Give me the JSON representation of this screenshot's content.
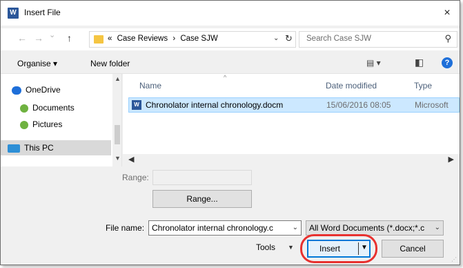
{
  "window": {
    "title": "Insert File",
    "close_glyph": "×"
  },
  "address": {
    "back_glyph": "←",
    "forward_glyph": "→",
    "recent_glyph": "⌄",
    "up_glyph": "↑",
    "overflow": "«",
    "breadcrumbs": [
      "Case Reviews",
      "Case SJW"
    ],
    "separator": "›",
    "dropdown_glyph": "⌄",
    "refresh_glyph": "↻"
  },
  "search": {
    "placeholder": "Search Case SJW",
    "icon_glyph": "⚲"
  },
  "toolbar": {
    "organise_label": "Organise ▾",
    "new_folder_label": "New folder",
    "view_glyph": "▤ ▾",
    "preview_glyph": "◧",
    "help_glyph": "?"
  },
  "navpane": {
    "items": [
      {
        "label": "OneDrive",
        "icon": "cloud-icon",
        "color": "#1e6fd9"
      },
      {
        "label": "Documents",
        "icon": "documents-icon",
        "color": "#6fb240"
      },
      {
        "label": "Pictures",
        "icon": "pictures-icon",
        "color": "#6fb240"
      },
      {
        "label": "This PC",
        "icon": "monitor-icon",
        "color": "#2d8fd6",
        "selected": true
      }
    ]
  },
  "filelist": {
    "columns": [
      "Name",
      "Date modified",
      "Type"
    ],
    "sort_glyph": "^",
    "files": [
      {
        "name": "Chronolator internal chronology.docm",
        "date_modified": "15/06/2016 08:05",
        "type": "Microsoft"
      }
    ]
  },
  "range": {
    "label": "Range:",
    "button_label": "Range..."
  },
  "file_name": {
    "label": "File name:",
    "value": "Chronolator internal chronology.c",
    "dropdown_glyph": "⌄"
  },
  "file_type": {
    "value": "All Word Documents (*.docx;*.c",
    "dropdown_glyph": "⌄"
  },
  "actions": {
    "tools_label": "Tools",
    "tools_dropdown_glyph": "▼",
    "insert_label": "Insert",
    "insert_dropdown_glyph": "▼",
    "cancel_label": "Cancel",
    "highlight_color": "#e8312f"
  }
}
